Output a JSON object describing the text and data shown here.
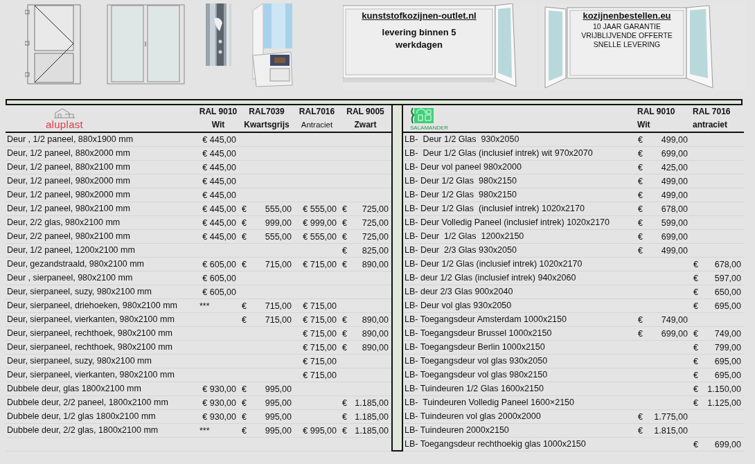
{
  "top_images": [
    {
      "kind": "door-drawing"
    },
    {
      "kind": "double-door-drawing"
    },
    {
      "kind": "picture"
    },
    {
      "kind": "picture"
    }
  ],
  "banners": [
    {
      "site": "kunststofkozijnen-outlet.nl",
      "lines": [
        "levering binnen 5 werkdagen"
      ]
    },
    {
      "site": "kozijnenbestellen.eu",
      "lines": [
        "10 JAAR GARANTIE",
        "VRIJBLIJVENDE OFFERTE",
        "SNELLE LEVERING"
      ]
    }
  ],
  "left_table": {
    "logo": "aluplast",
    "columns": [
      {
        "code": "RAL 9010",
        "color_name": "Wit",
        "name_bold": true
      },
      {
        "code": "RAL7039",
        "color_name": "Kwartsgrijs",
        "name_bold": true
      },
      {
        "code": "RAL7016",
        "color_name": "Antraciet",
        "name_bold": false
      },
      {
        "code": "RAL 9005",
        "color_name": "Zwart",
        "name_bold": true
      }
    ],
    "rows": [
      {
        "name": "Deur , 1/2 paneel, 880x1900 mm",
        "prices": {
          "column_1": {
            "symbol": "€",
            "amount": "445,00"
          }
        }
      },
      {
        "name": "Deur, 1/2 paneel, 880x2000 mm",
        "prices": {
          "column_1": {
            "symbol": "€",
            "amount": "445,00"
          }
        }
      },
      {
        "name": "Deur, 1/2 paneel, 880x2100 mm",
        "prices": {
          "column_1": {
            "symbol": "€",
            "amount": "445,00"
          }
        }
      },
      {
        "name": "Deur, 1/2 paneel, 980x2000 mm",
        "prices": {
          "column_1": {
            "symbol": "€",
            "amount": "445,00"
          }
        }
      },
      {
        "name": "Deur, 1/2 paneel, 980x2000 mm",
        "prices": {
          "column_1": {
            "symbol": "€",
            "amount": "445,00"
          }
        }
      },
      {
        "name": "Deur, 1/2 paneel, 980x2100 mm",
        "prices": {
          "column_1": {
            "symbol": "€",
            "amount": "445,00"
          },
          "column_2": {
            "symbol": "€",
            "amount": "555,00"
          },
          "column_3": {
            "symbol": "€",
            "amount": "555,00"
          },
          "column_4": {
            "symbol": "€",
            "amount": "725,00"
          }
        }
      },
      {
        "name": "Deur, 2/2 glas, 980x2100 mm",
        "prices": {
          "column_1": {
            "symbol": "€",
            "amount": "445,00"
          },
          "column_2": {
            "symbol": "€",
            "amount": "999,00"
          },
          "column_3": {
            "symbol": "€",
            "amount": "999,00"
          },
          "column_4": {
            "symbol": "€",
            "amount": "725,00"
          }
        }
      },
      {
        "name": "Deur, 2/2 paneel, 980x2100 mm",
        "prices": {
          "column_1": {
            "symbol": "€",
            "amount": "445,00"
          },
          "column_2": {
            "symbol": "€",
            "amount": "555,00"
          },
          "column_3": {
            "symbol": "€",
            "amount": "555,00"
          },
          "column_4": {
            "symbol": "€",
            "amount": "725,00"
          }
        }
      },
      {
        "name": "Deur, 1/2 paneel, 1200x2100 mm",
        "prices": {
          "column_4": {
            "symbol": "€",
            "amount": "825,00"
          }
        }
      },
      {
        "name": "Deur, gezandstraald, 980x2100 mm",
        "prices": {
          "column_1": {
            "symbol": "€",
            "amount": "605,00"
          },
          "column_2": {
            "symbol": "€",
            "amount": "715,00"
          },
          "column_3": {
            "symbol": "€",
            "amount": "715,00"
          },
          "column_4": {
            "symbol": "€",
            "amount": "890,00"
          }
        }
      },
      {
        "name": "Deur , sierpaneel, 980x2100 mm",
        "prices": {
          "column_1": {
            "symbol": "€",
            "amount": "605,00"
          }
        }
      },
      {
        "name": "Deur, sierpaneel, suzy, 980x2100 mm",
        "prices": {
          "column_1": {
            "symbol": "€",
            "amount": "605,00"
          }
        }
      },
      {
        "name": "Deur, sierpaneel, driehoeken, 980x2100 mm",
        "prices": {
          "column_1": {
            "note": "***"
          },
          "column_2": {
            "symbol": "€",
            "amount": "715,00"
          },
          "column_3": {
            "symbol": "€",
            "amount": "715,00"
          }
        }
      },
      {
        "name": "Deur, sierpaneel, vierkanten, 980x2100 mm",
        "prices": {
          "column_2": {
            "symbol": "€",
            "amount": "715,00"
          },
          "column_3": {
            "symbol": "€",
            "amount": "715,00"
          },
          "column_4": {
            "symbol": "€",
            "amount": "890,00"
          }
        }
      },
      {
        "name": "Deur, sierpaneel, rechthoek, 980x2100 mm",
        "prices": {
          "column_3": {
            "symbol": "€",
            "amount": "715,00"
          },
          "column_4": {
            "symbol": "€",
            "amount": "890,00"
          }
        }
      },
      {
        "name": "Deur, sierpaneel, rechthoek, 980x2100 mm",
        "prices": {
          "column_3": {
            "symbol": "€",
            "amount": "715,00"
          },
          "column_4": {
            "symbol": "€",
            "amount": "890,00"
          }
        }
      },
      {
        "name": "Deur, sierpaneel, suzy, 980x2100 mm",
        "prices": {
          "column_3": {
            "symbol": "€",
            "amount": "715,00"
          }
        }
      },
      {
        "name": "Deur, sierpaneel, vierkanten, 980x2100 mm",
        "prices": {
          "column_3": {
            "symbol": "€",
            "amount": "715,00"
          }
        }
      },
      {
        "name": "Dubbele deur, glas 1800x2100 mm",
        "prices": {
          "column_1": {
            "symbol": "€",
            "amount": "930,00"
          },
          "column_2": {
            "symbol": "€",
            "amount": "995,00"
          }
        }
      },
      {
        "name": "Dubbele deur, 2/2 paneel, 1800x2100 mm",
        "prices": {
          "column_1": {
            "symbol": "€",
            "amount": "930,00"
          },
          "column_2": {
            "symbol": "€",
            "amount": "995,00"
          },
          "column_4": {
            "symbol": "€",
            "amount": "1.185,00"
          }
        }
      },
      {
        "name": "Dubbele deur, 1/2 glas 1800x2100 mm",
        "prices": {
          "column_1": {
            "symbol": "€",
            "amount": "930,00"
          },
          "column_2": {
            "symbol": "€",
            "amount": "995,00"
          },
          "column_4": {
            "symbol": "€",
            "amount": "1.185,00"
          }
        }
      },
      {
        "name": "Dubbele deur, 2/2 glas, 1800x2100 mm",
        "prices": {
          "column_1": {
            "note": "***"
          },
          "column_2": {
            "symbol": "€",
            "amount": "995,00"
          },
          "column_3": {
            "symbol": "€",
            "amount": "995,00"
          },
          "column_4": {
            "symbol": "€",
            "amount": "1.185,00"
          }
        }
      }
    ]
  },
  "right_table": {
    "logo": "SALAMANDER",
    "columns": [
      {
        "code": "RAL 9010",
        "color_name": "Wit",
        "name_bold": true
      },
      {
        "code": "RAL 7016",
        "color_name": "antraciet",
        "name_bold": true
      }
    ],
    "rows": [
      {
        "name": "LB-  Deur 1/2 Glas  930x2050",
        "prices": {
          "column_1": {
            "symbol": "€",
            "amount": "499,00"
          }
        }
      },
      {
        "name": "LB-  Deur 1/2 Glas (inclusief intrek) wit 970x2070",
        "prices": {
          "column_1": {
            "symbol": "€",
            "amount": "699,00"
          }
        }
      },
      {
        "name": "LB- Deur vol paneel 980x2000",
        "prices": {
          "column_1": {
            "symbol": "€",
            "amount": "425,00"
          }
        }
      },
      {
        "name": "LB- Deur 1/2 Glas  980x2150",
        "prices": {
          "column_1": {
            "symbol": "€",
            "amount": "499,00"
          }
        }
      },
      {
        "name": "LB- Deur 1/2 Glas  980x2150",
        "prices": {
          "column_1": {
            "symbol": "€",
            "amount": "499,00"
          }
        }
      },
      {
        "name": "LB- Deur 1/2 Glas  (inclusief intrek) 1020x2170",
        "prices": {
          "column_1": {
            "symbol": "€",
            "amount": "678,00"
          }
        }
      },
      {
        "name": "LB- Deur Volledig Paneel (inclusief intrek) 1020x2170",
        "prices": {
          "column_1": {
            "symbol": "€",
            "amount": "599,00"
          }
        }
      },
      {
        "name": "LB- Deur  1/2 Glas  1200x2150",
        "prices": {
          "column_1": {
            "symbol": "€",
            "amount": "699,00"
          }
        }
      },
      {
        "name": "LB- Deur  2/3 Glas 930x2050",
        "prices": {
          "column_1": {
            "symbol": "€",
            "amount": "499,00"
          }
        }
      },
      {
        "name": "LB- Deur 1/2 Glas (inclusief intrek) 1020x2170",
        "prices": {
          "column_2": {
            "symbol": "€",
            "amount": "678,00"
          }
        }
      },
      {
        "name": "LB- deur 1/2 Glas (inclusief intrek) 940x2060",
        "prices": {
          "column_2": {
            "symbol": "€",
            "amount": "597,00"
          }
        }
      },
      {
        "name": "LB- deur 2/3 Glas 900x2040",
        "prices": {
          "column_2": {
            "symbol": "€",
            "amount": "650,00"
          }
        }
      },
      {
        "name": "LB- Deur vol glas 930x2050",
        "prices": {
          "column_2": {
            "symbol": "€",
            "amount": "695,00"
          }
        }
      },
      {
        "name": "LB- Toegangsdeur Amsterdam 1000x2150",
        "prices": {
          "column_1": {
            "symbol": "€",
            "amount": "749,00"
          }
        }
      },
      {
        "name": "LB- Toegangsdeur Brussel 1000x2150",
        "prices": {
          "column_1": {
            "symbol": "€",
            "amount": "699,00"
          },
          "column_2": {
            "symbol": "€",
            "amount": "749,00"
          }
        }
      },
      {
        "name": "LB- Toegangsdeur Berlin 1000x2150",
        "prices": {
          "column_2": {
            "symbol": "€",
            "amount": "799,00"
          }
        }
      },
      {
        "name": "LB- Toegangsdeur vol glas 930x2050",
        "prices": {
          "column_2": {
            "symbol": "€",
            "amount": "695,00"
          }
        }
      },
      {
        "name": "LB- Toegangsdeur vol glas 980x2150",
        "prices": {
          "column_2": {
            "symbol": "€",
            "amount": "695,00"
          }
        }
      },
      {
        "name": "LB- Tuindeuren 1/2 Glas 1600x2150",
        "prices": {
          "column_2": {
            "symbol": "€",
            "amount": "1.150,00"
          }
        }
      },
      {
        "name": "LB-  Tuindeuren Volledig Paneel 1600×2150",
        "prices": {
          "column_2": {
            "symbol": "€",
            "amount": "1.125,00"
          }
        }
      },
      {
        "name": "LB- Tuindeuren vol glas 2000x2000",
        "prices": {
          "column_1": {
            "symbol": "€",
            "amount": "1.775,00"
          }
        }
      },
      {
        "name": "LB- Tuindeuren 2000x2150",
        "prices": {
          "column_1": {
            "symbol": "€",
            "amount": "1.815,00"
          }
        }
      },
      {
        "name": "LB- Toegangsdeur rechthoekig glas 1000x2150",
        "prices": {
          "column_2": {
            "symbol": "€",
            "amount": "699,00"
          }
        }
      }
    ]
  }
}
